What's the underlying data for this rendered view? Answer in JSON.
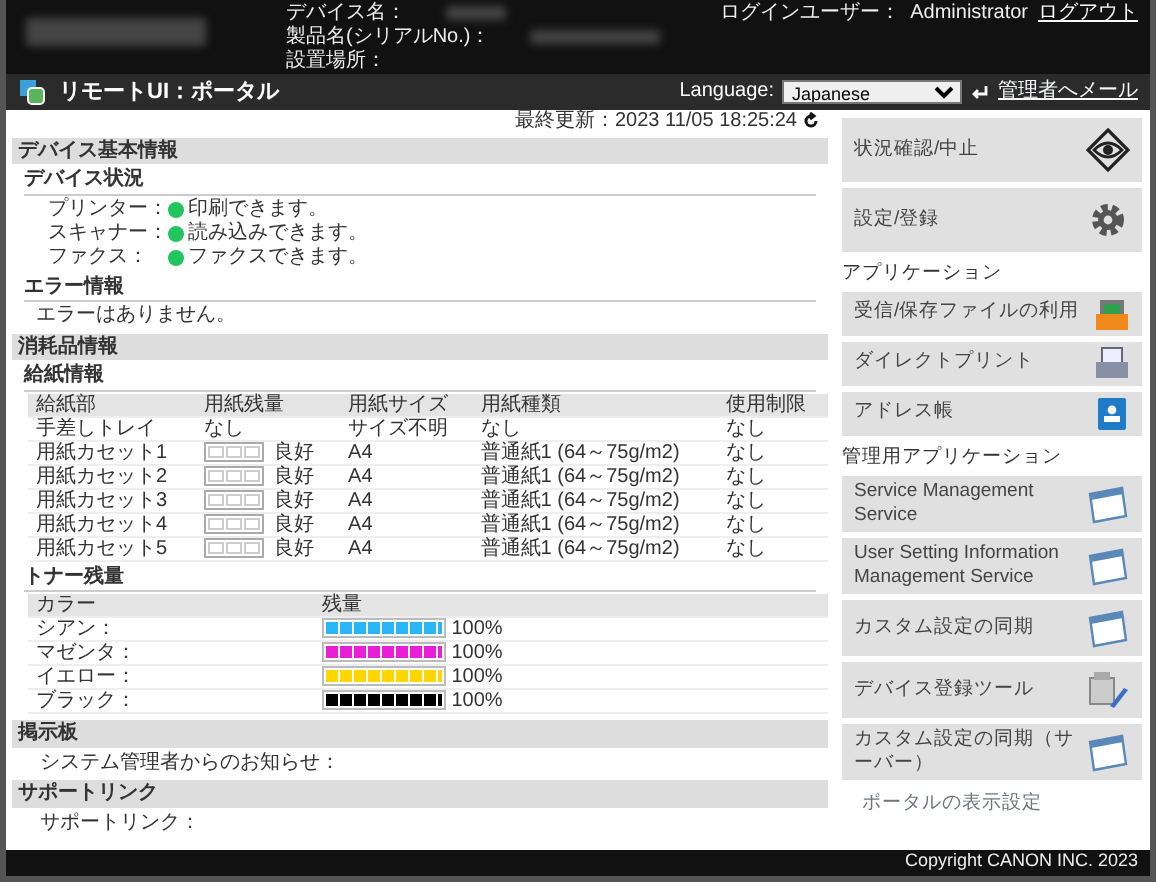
{
  "header": {
    "device_fields": [
      {
        "label": "デバイス名："
      },
      {
        "label": "製品名(シリアルNo.)："
      },
      {
        "label": "設置場所："
      }
    ],
    "login_label": "ログインユーザー：",
    "login_user": "Administrator",
    "logout": "ログアウト"
  },
  "title_bar": {
    "title": "リモートUI：ポータル",
    "language_label": "Language:",
    "language_value": "Japanese",
    "mail_link": "管理者へメール"
  },
  "last_updated": "最終更新：2023 11/05 18:25:24",
  "device_info": {
    "heading": "デバイス基本情報",
    "status_heading": "デバイス状況",
    "statuses": [
      {
        "label": "プリンター：",
        "text": "印刷できます。",
        "color": "#22c55e"
      },
      {
        "label": "スキャナー：",
        "text": "読み込みできます。",
        "color": "#22c55e"
      },
      {
        "label": "ファクス：",
        "text": "ファクスできます。",
        "color": "#22c55e"
      }
    ],
    "error_heading": "エラー情報",
    "error_text": "エラーはありません。"
  },
  "consumables": {
    "heading": "消耗品情報",
    "paper_heading": "給紙情報",
    "paper_columns": [
      "給紙部",
      "用紙残量",
      "用紙サイズ",
      "用紙種類",
      "使用制限"
    ],
    "paper_rows": [
      {
        "source": "手差しトレイ",
        "remaining": "なし",
        "gauge": false,
        "size": "サイズ不明",
        "type": "なし",
        "limit": "なし"
      },
      {
        "source": "用紙カセット1",
        "remaining": "良好",
        "gauge": true,
        "size": "A4",
        "type": "普通紙1 (64～75g/m2)",
        "limit": "なし"
      },
      {
        "source": "用紙カセット2",
        "remaining": "良好",
        "gauge": true,
        "size": "A4",
        "type": "普通紙1 (64～75g/m2)",
        "limit": "なし"
      },
      {
        "source": "用紙カセット3",
        "remaining": "良好",
        "gauge": true,
        "size": "A4",
        "type": "普通紙1 (64～75g/m2)",
        "limit": "なし"
      },
      {
        "source": "用紙カセット4",
        "remaining": "良好",
        "gauge": true,
        "size": "A4",
        "type": "普通紙1 (64～75g/m2)",
        "limit": "なし"
      },
      {
        "source": "用紙カセット5",
        "remaining": "良好",
        "gauge": true,
        "size": "A4",
        "type": "普通紙1 (64～75g/m2)",
        "limit": "なし"
      }
    ],
    "toner_heading": "トナー残量",
    "toner_columns": [
      "カラー",
      "残量"
    ],
    "toners": [
      {
        "name": "シアン：",
        "color": "#29b6f6",
        "level": 1,
        "reading": "100%"
      },
      {
        "name": "マゼンタ：",
        "color": "#e91ed6",
        "level": 1,
        "reading": "100%"
      },
      {
        "name": "イエロー：",
        "color": "#ffd600",
        "level": 1,
        "reading": "100%"
      },
      {
        "name": "ブラック：",
        "color": "#000000",
        "level": 1,
        "reading": "100%"
      }
    ]
  },
  "notice": {
    "heading": "掲示板",
    "text": "システム管理者からのお知らせ："
  },
  "support": {
    "heading": "サポートリンク",
    "text": "サポートリンク："
  },
  "sidebar": {
    "top_buttons": [
      {
        "label": "状況確認/中止"
      },
      {
        "label": "設定/登録"
      }
    ],
    "apps_heading": "アプリケーション",
    "apps": [
      {
        "label": "受信/保存ファイルの利用"
      },
      {
        "label": "ダイレクトプリント"
      },
      {
        "label": "アドレス帳"
      }
    ],
    "admin_heading": "管理用アプリケーション",
    "admin_apps": [
      {
        "label": "Service Management Service"
      },
      {
        "label": "User Setting Information Management Service"
      },
      {
        "label": "カスタム設定の同期"
      },
      {
        "label": "デバイス登録ツール"
      },
      {
        "label": "カスタム設定の同期（サーバー）"
      }
    ],
    "portal_settings": "ポータルの表示設定"
  },
  "footer": "Copyright CANON INC. 2023"
}
